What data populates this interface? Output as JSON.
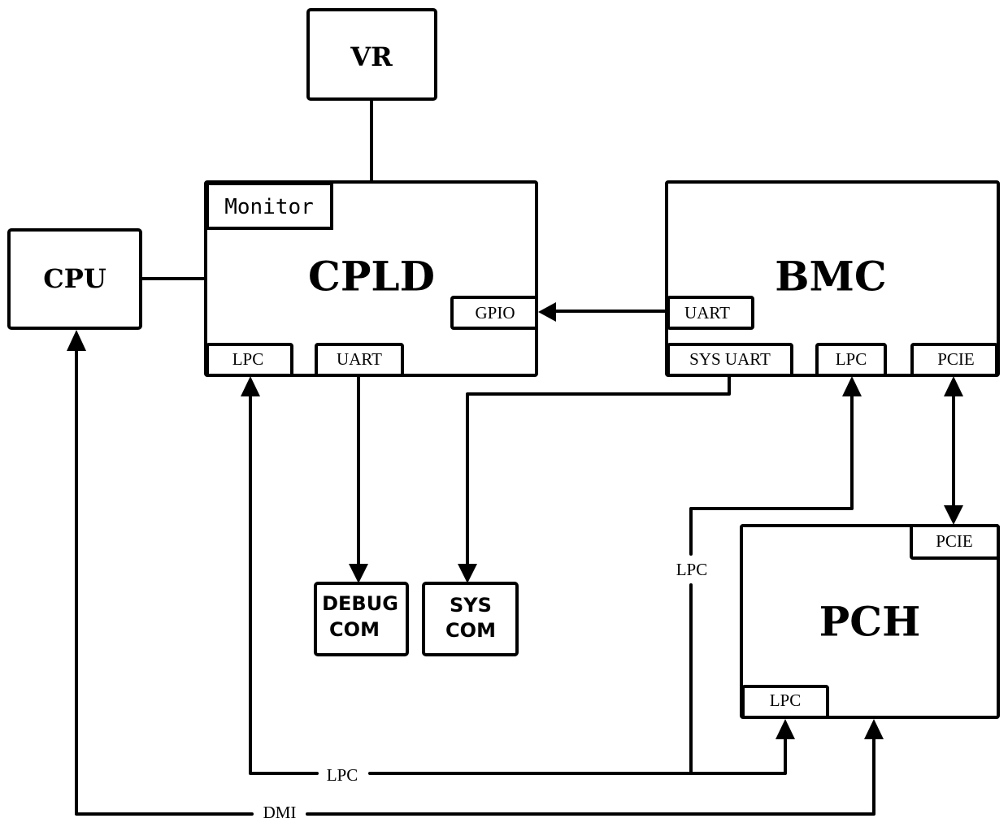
{
  "diagram": {
    "blocks": {
      "vr": {
        "label": "VR"
      },
      "cpu": {
        "label": "CPU"
      },
      "cpld": {
        "label": "CPLD",
        "ports": {
          "monitor": "Monitor",
          "gpio": "GPIO",
          "lpc": "LPC",
          "uart": "UART"
        }
      },
      "bmc": {
        "label": "BMC",
        "ports": {
          "uart": "UART",
          "sys_uart": "SYS UART",
          "lpc": "LPC",
          "pcie": "PCIE"
        }
      },
      "pch": {
        "label": "PCH",
        "ports": {
          "pcie": "PCIE",
          "lpc": "LPC"
        }
      },
      "debug_com": {
        "line1": "DEBUG",
        "line2": "COM"
      },
      "sys_com": {
        "line1": "SYS",
        "line2": "COM"
      }
    },
    "bus_labels": {
      "lpc_vertical": "LPC",
      "lpc_bottom": "LPC",
      "dmi": "DMI"
    },
    "connections": [
      {
        "from": "VR",
        "to": "CPLD.Monitor",
        "direction": "one-way"
      },
      {
        "from": "CPU",
        "to": "CPLD.Monitor",
        "direction": "one-way"
      },
      {
        "from": "BMC.UART",
        "to": "CPLD.GPIO",
        "direction": "one-way"
      },
      {
        "from": "CPLD.UART",
        "to": "DEBUG COM",
        "direction": "one-way"
      },
      {
        "from": "BMC.SYS UART",
        "to": "SYS COM",
        "direction": "one-way"
      },
      {
        "from": "BMC.PCIE",
        "to": "PCH.PCIE",
        "direction": "two-way"
      },
      {
        "from": "LPC bus",
        "to": "CPLD.LPC",
        "direction": "one-way"
      },
      {
        "from": "LPC bus",
        "to": "BMC.LPC",
        "direction": "one-way"
      },
      {
        "from": "LPC bus",
        "to": "PCH.LPC",
        "direction": "one-way"
      },
      {
        "from": "DMI",
        "to": "CPU",
        "direction": "one-way"
      },
      {
        "from": "DMI",
        "to": "PCH",
        "direction": "one-way"
      }
    ]
  }
}
